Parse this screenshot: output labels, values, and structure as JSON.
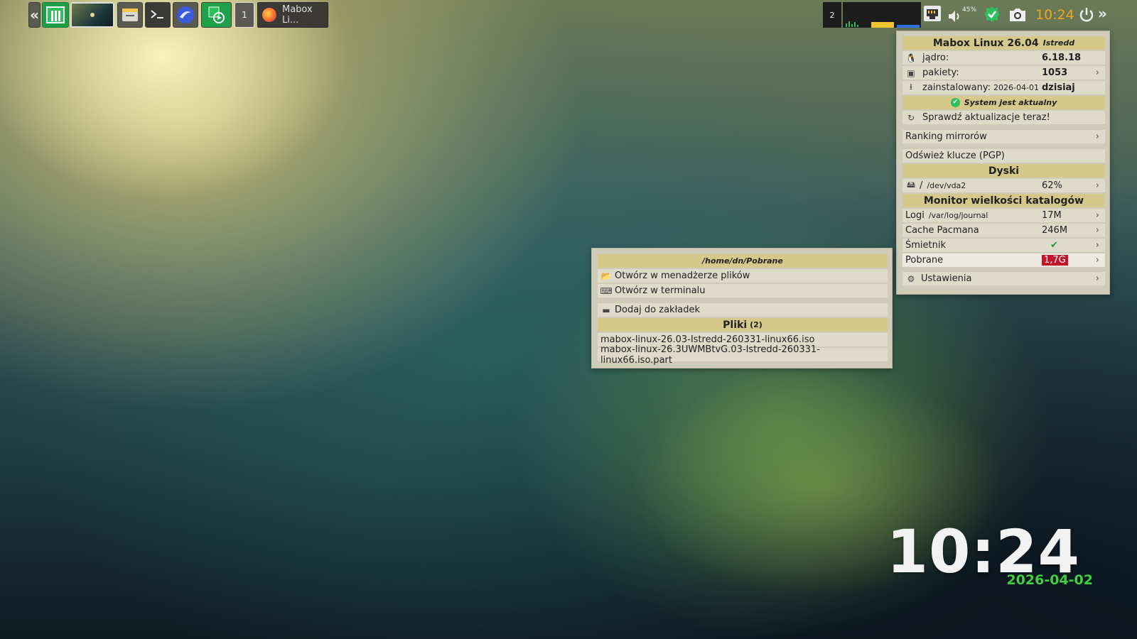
{
  "panel": {
    "collapse_left": "«",
    "workspace_indicator": "1",
    "task_title": "Mabox Li...",
    "tray_workspace_count": "2",
    "volume_percent": "45%",
    "clock": "10:24",
    "expand_right": "»"
  },
  "sysinfo_menu": {
    "title": "Mabox Linux 26.04",
    "codename": "Istredd",
    "kernel": {
      "label": "jądro:",
      "value": "6.18.18"
    },
    "packages": {
      "label": "pakiety:",
      "value": "1053"
    },
    "installed": {
      "label": "zainstalowany:",
      "date": "2026-04-01",
      "value": "dzisiaj"
    },
    "status": "System jest aktualny",
    "check_updates": "Sprawdź aktualizacje teraz!",
    "mirror_ranking": "Ranking mirrorów",
    "refresh_keys": "Odśwież klucze (PGP)",
    "disks_header": "Dyski",
    "disk": {
      "mount": "/",
      "device": "/dev/vda2",
      "usage": "62%"
    },
    "dirmon_header": "Monitor wielkości katalogów",
    "dirs": [
      {
        "label": "Logi",
        "path": "/var/log/journal",
        "value": "17M"
      },
      {
        "label": "Cache Pacmana",
        "path": "",
        "value": "246M"
      },
      {
        "label": "Śmietnik",
        "path": "",
        "value": "✔"
      },
      {
        "label": "Pobrane",
        "path": "",
        "value": "1,7G"
      }
    ],
    "settings": "Ustawienia"
  },
  "submenu": {
    "path_header": "/home/dn/Pobrane",
    "open_file_manager": "Otwórz w menadżerze plików",
    "open_terminal": "Otwórz w terminalu",
    "add_bookmark": "Dodaj do zakładek",
    "files_header": "Pliki",
    "files_count": "(2)",
    "files": [
      "mabox-linux-26.03-Istredd-260331-linux66.iso",
      "mabox-linux-26.3UWMBtvG.03-Istredd-260331-linux66.iso.part"
    ]
  },
  "desktop_clock": {
    "time": "10:24",
    "date": "2026-04-02"
  },
  "colors": {
    "menu_bg": "#cfcbb9",
    "menu_header": "#d4c98a",
    "accent_green": "#3fcf3f",
    "alert_red": "#c0162a"
  }
}
